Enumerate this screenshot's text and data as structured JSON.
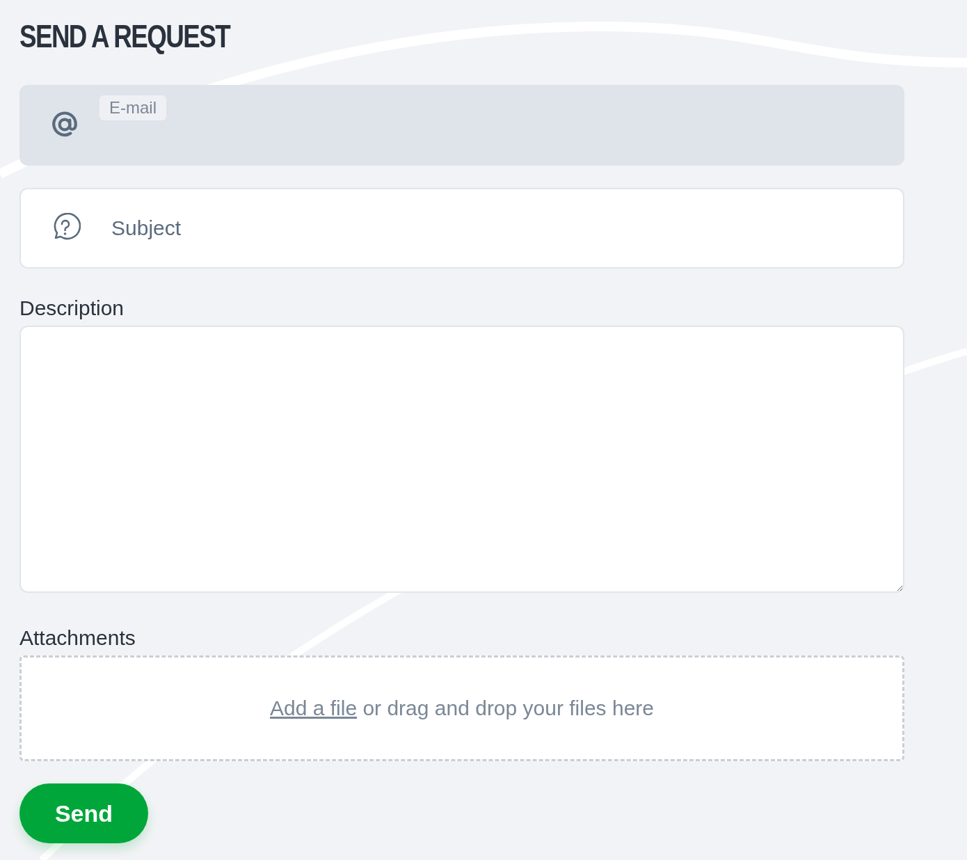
{
  "title": "SEND A REQUEST",
  "email_field": {
    "label": "E-mail"
  },
  "subject_field": {
    "placeholder": "Subject"
  },
  "description": {
    "label": "Description"
  },
  "attachments": {
    "label": "Attachments",
    "link": "Add a file",
    "text": "or drag and drop your files here"
  },
  "send_button": "Send"
}
